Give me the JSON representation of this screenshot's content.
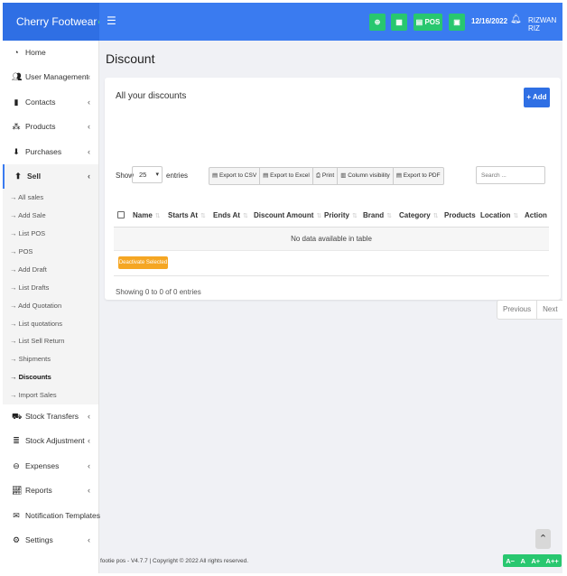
{
  "brand": {
    "name": "Cherry Footwear",
    "status_color": "#4cd964"
  },
  "topbar": {
    "menu_icon": "hamburger-icon",
    "buttons": [
      {
        "icon": "plus-circle-icon",
        "label": ""
      },
      {
        "icon": "calculator-icon",
        "label": ""
      },
      {
        "icon": "grid-icon",
        "label": "POS"
      },
      {
        "icon": "cash-icon",
        "label": ""
      }
    ],
    "date": "12/16/2022",
    "bell_icon": "bell-icon",
    "user": "RIZWAN RIZ"
  },
  "sidebar": {
    "items": [
      {
        "label": "Home",
        "icon": "dashboard-icon",
        "chevron": false
      },
      {
        "label": "User Management",
        "icon": "users-icon",
        "chevron": true
      },
      {
        "label": "Contacts",
        "icon": "address-book-icon",
        "chevron": true
      },
      {
        "label": "Products",
        "icon": "cubes-icon",
        "chevron": true
      },
      {
        "label": "Purchases",
        "icon": "arrow-circle-down-icon",
        "chevron": true
      },
      {
        "label": "Sell",
        "icon": "arrow-circle-up-icon",
        "chevron": true,
        "active": true
      }
    ],
    "sell_submenu": [
      "→ All sales",
      "→ Add Sale",
      "→ List POS",
      "→ POS",
      "→ Add Draft",
      "→ List Drafts",
      "→ Add Quotation",
      "→ List quotations",
      "→ List Sell Return",
      "→ Shipments",
      "→ Discounts",
      "→ Import Sales"
    ],
    "active_submenu_index": 10,
    "items_after": [
      {
        "label": "Stock Transfers",
        "icon": "truck-icon",
        "chevron": true
      },
      {
        "label": "Stock Adjustment",
        "icon": "database-icon",
        "chevron": true
      },
      {
        "label": "Expenses",
        "icon": "minus-circle-icon",
        "chevron": true
      },
      {
        "label": "Reports",
        "icon": "chart-icon",
        "chevron": true
      },
      {
        "label": "Notification Templates",
        "icon": "envelope-icon",
        "chevron": false
      },
      {
        "label": "Settings",
        "icon": "cog-icon",
        "chevron": true
      }
    ]
  },
  "main": {
    "page_title": "Discount",
    "box_title": "All your discounts",
    "add_label": "+ Add",
    "show_label": "Show",
    "entries_value": "25",
    "entries_label": "entries",
    "exports": [
      "Export to CSV",
      "Export to Excel",
      "Print",
      "Column visibility",
      "Export to PDF"
    ],
    "search_placeholder": "Search ...",
    "columns": [
      "Name",
      "Starts At",
      "Ends At",
      "Discount Amount",
      "Priority",
      "Brand",
      "Category",
      "Products",
      "Location",
      "Action"
    ],
    "empty_text": "No data available in table",
    "deactivate_label": "Deactivate Selected",
    "showing_text": "Showing 0 to 0 of 0 entries",
    "pager": {
      "prev": "Previous",
      "next": "Next"
    }
  },
  "footer": {
    "text": "footie pos - V4.7.7 | Copyright © 2022 All rights reserved.",
    "font_tools": [
      "A−",
      "A",
      "A+",
      "A++"
    ],
    "accent_color": "#28c76f"
  }
}
